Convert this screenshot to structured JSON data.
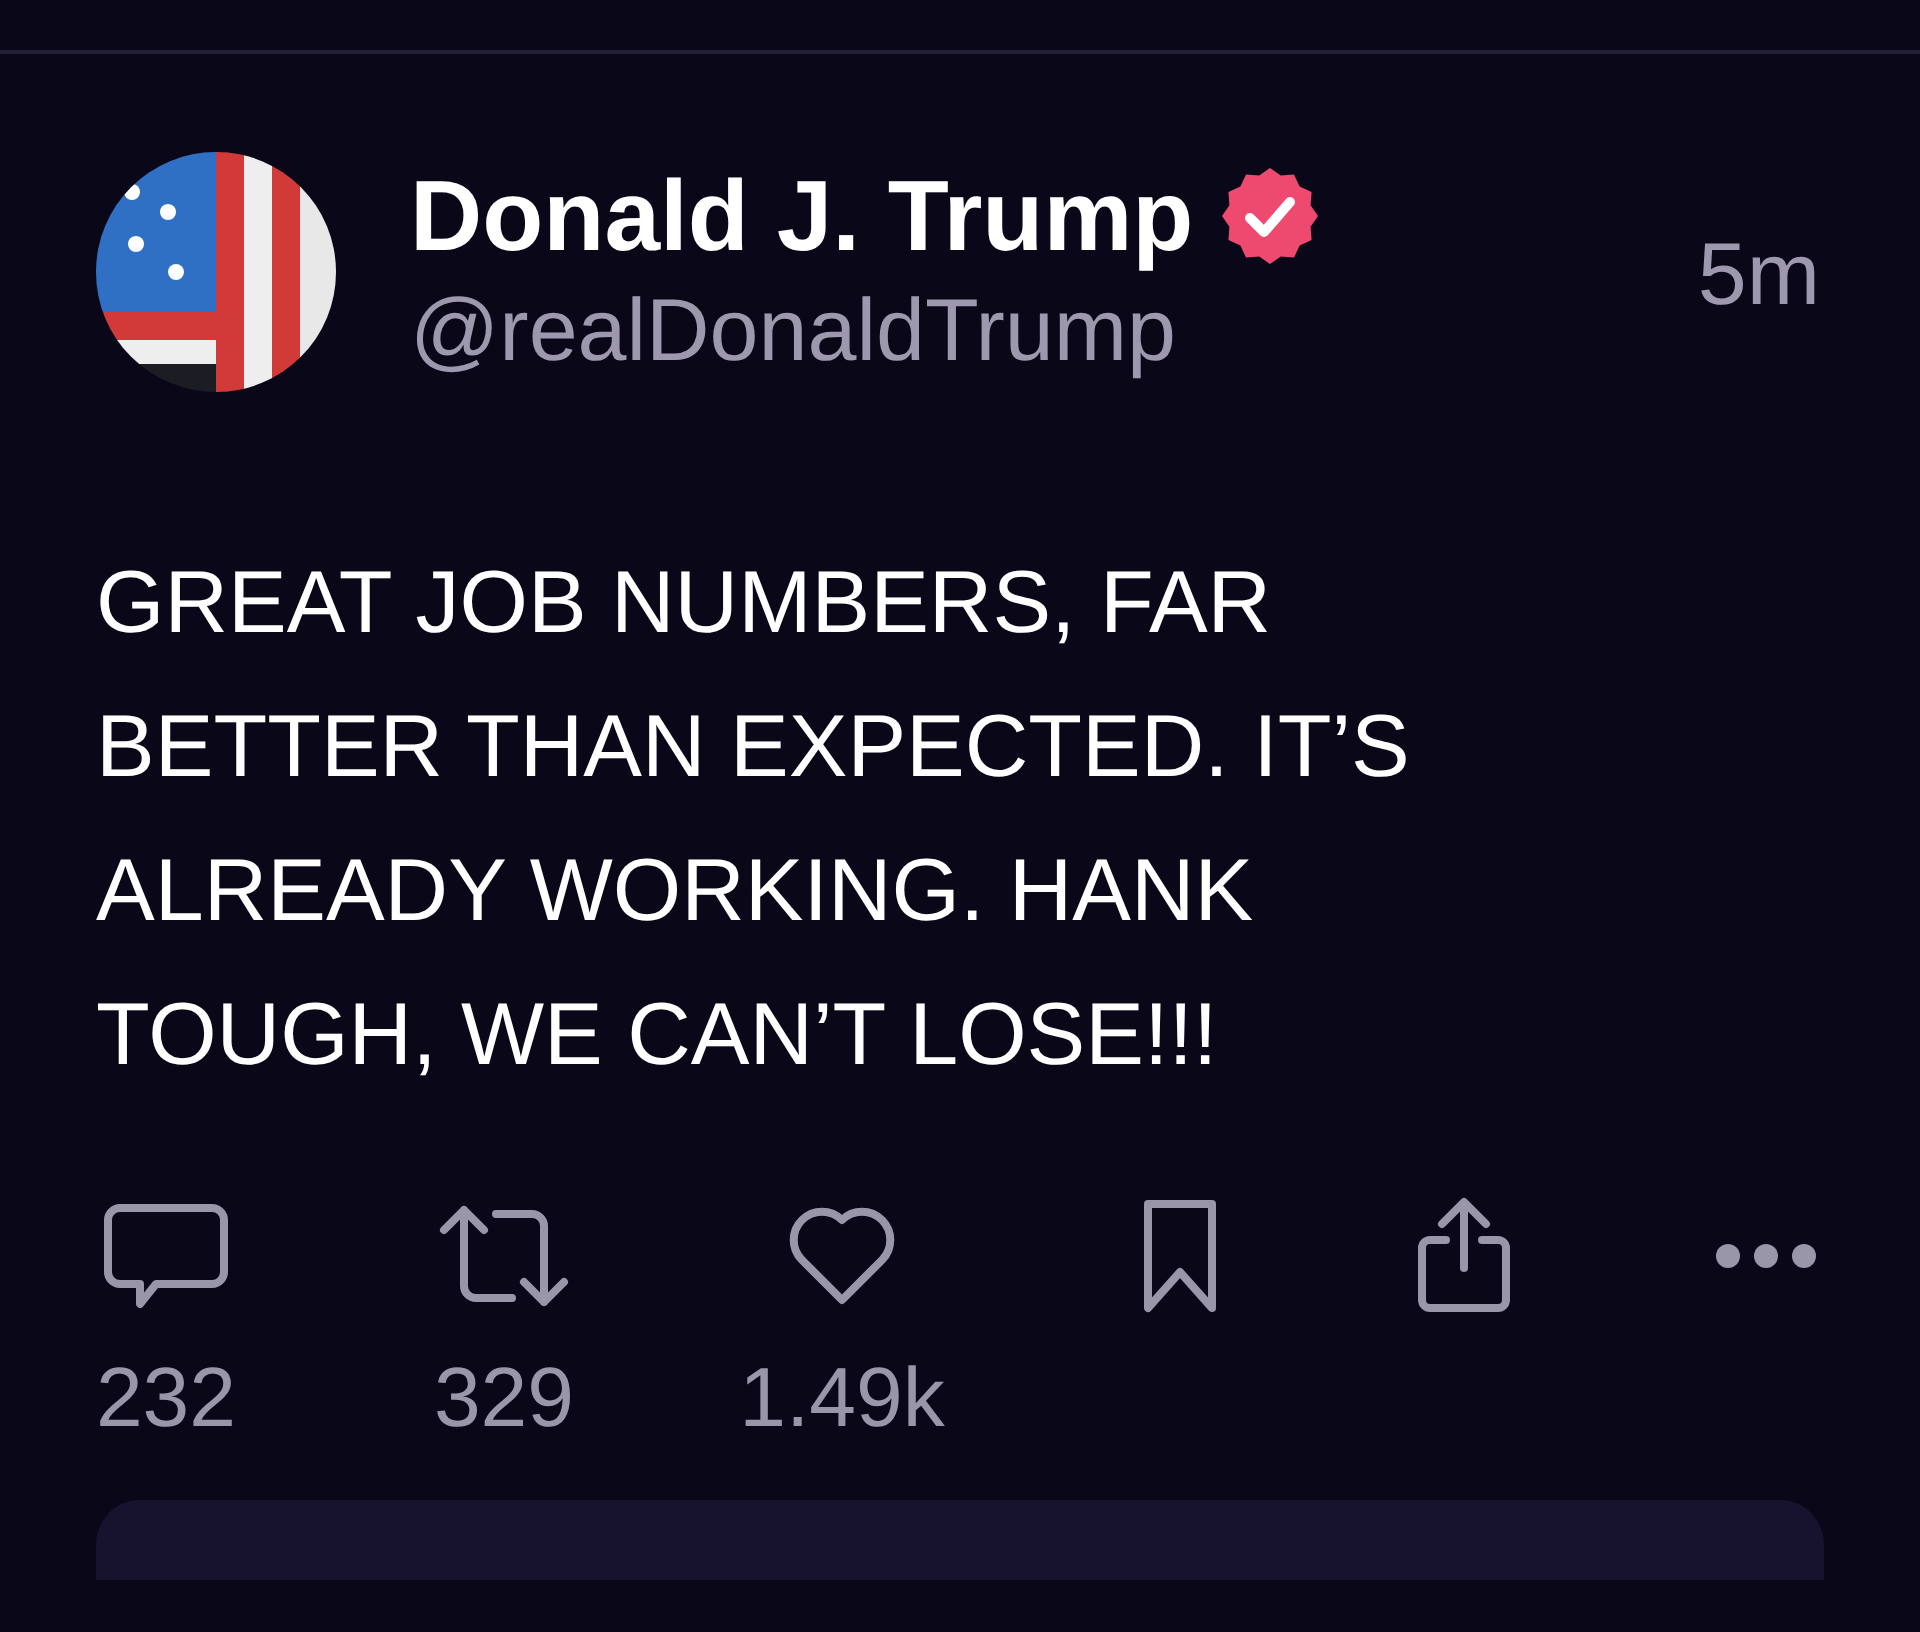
{
  "post": {
    "author": {
      "name": "Donald J. Trump",
      "verified": true,
      "handle": "@realDonaldTrump"
    },
    "time": "5m",
    "text": "GREAT JOB NUMBERS, FAR BETTER THAN EXPECTED. IT’S ALREADY WORKING. HANK TOUGH, WE CAN’T LOSE!!!",
    "actions": [
      {
        "kind": "reply",
        "count": "232"
      },
      {
        "kind": "repost",
        "count": "329"
      },
      {
        "kind": "like",
        "count": "1.49k"
      },
      {
        "kind": "bookmark"
      },
      {
        "kind": "share"
      },
      {
        "kind": "more"
      }
    ]
  }
}
